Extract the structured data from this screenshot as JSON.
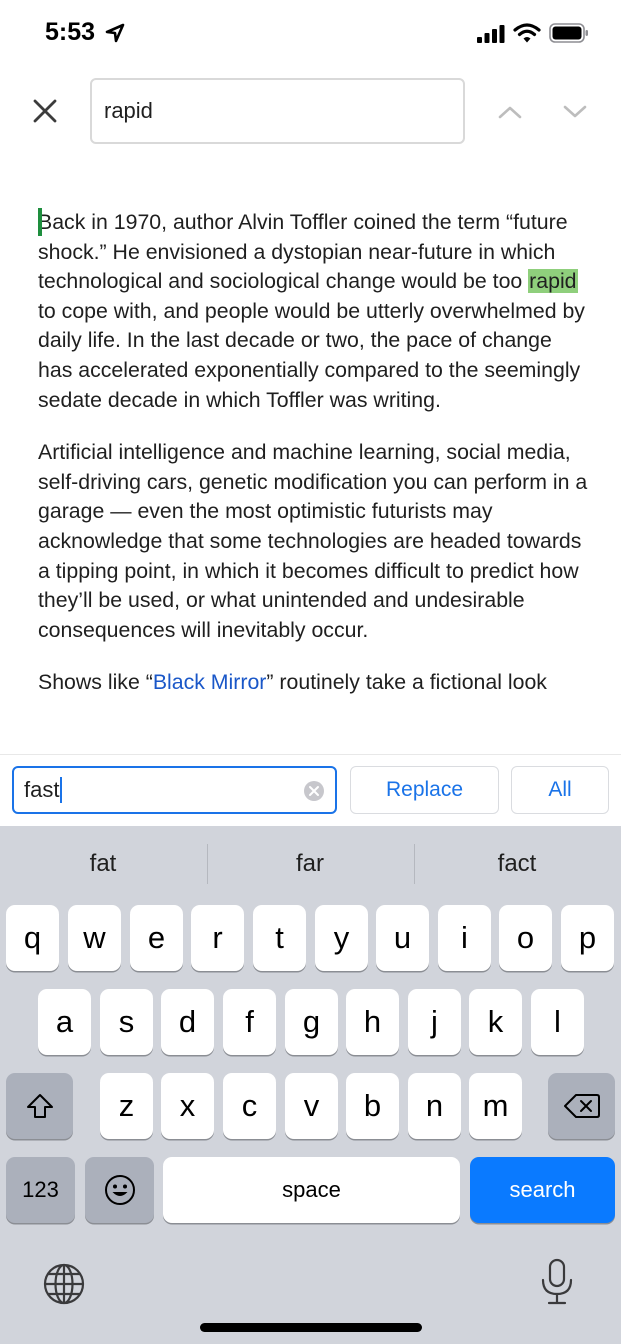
{
  "status_bar": {
    "time": "5:53"
  },
  "find": {
    "query": "rapid"
  },
  "document": {
    "para1_before": "Back in 1970, author Alvin Toffler coined the term “future shock.” He envisioned a dystopian near-future in which technological and sociological change would be too ",
    "para1_highlight": "rapid",
    "para1_after": " to cope with, and people would be utterly overwhelmed by daily life. In the last decade or two, the pace of change has accelerated exponentially compared to the seemingly sedate decade in which Toffler was writing.",
    "para2": "Artificial intelligence and machine learning, social media, self-driving cars, genetic modification you can perform in a garage — even the most optimistic futurists may acknowledge that some technologies are headed towards a tipping point, in which it becomes difficult to predict how they’ll be used, or what unintended and undesirable consequences will inevitably occur.",
    "para3_before": "Shows like “",
    "para3_link": "Black Mirror",
    "para3_after": "” routinely take a fictional look"
  },
  "replace": {
    "value": "fast",
    "replace_label": "Replace",
    "all_label": "All"
  },
  "keyboard": {
    "suggestions": [
      "fat",
      "far",
      "fact"
    ],
    "row1": [
      "q",
      "w",
      "e",
      "r",
      "t",
      "y",
      "u",
      "i",
      "o",
      "p"
    ],
    "row2": [
      "a",
      "s",
      "d",
      "f",
      "g",
      "h",
      "j",
      "k",
      "l"
    ],
    "row3": [
      "z",
      "x",
      "c",
      "v",
      "b",
      "n",
      "m"
    ],
    "numbers_label": "123",
    "space_label": "space",
    "search_label": "search"
  },
  "colors": {
    "accent": "#1a73e8",
    "highlight": "#8fcf7c",
    "search_key": "#0a7aff"
  },
  "icons": [
    "location-arrow-icon",
    "signal-icon",
    "wifi-icon",
    "battery-icon",
    "close-icon",
    "chevron-up-icon",
    "chevron-down-icon",
    "clear-icon",
    "shift-icon",
    "emoji-icon",
    "backspace-icon",
    "globe-icon",
    "microphone-icon"
  ]
}
